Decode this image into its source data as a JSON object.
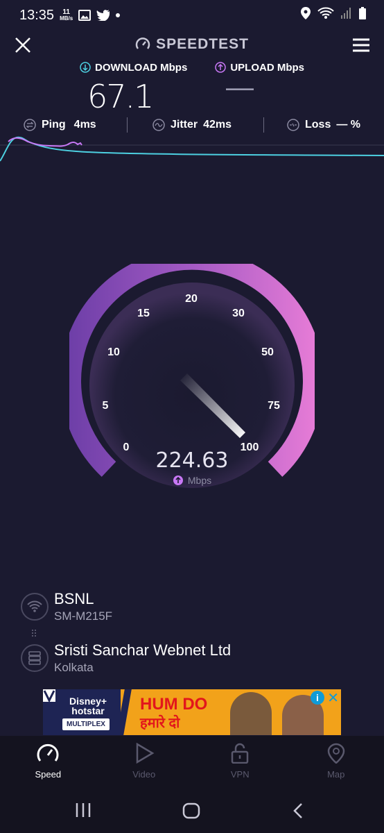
{
  "status_bar": {
    "time": "13:35",
    "net_speed_value": "11",
    "net_speed_unit": "MB/s",
    "icons": [
      "gallery-icon",
      "twitter-icon",
      "dot-icon",
      "location-icon",
      "wifi-icon",
      "signal-icon",
      "battery-icon"
    ]
  },
  "header": {
    "brand": "SPEEDTEST",
    "close_icon": "close-icon",
    "menu_icon": "hamburger-menu-icon"
  },
  "legend": {
    "download_label": "DOWNLOAD Mbps",
    "upload_label": "UPLOAD Mbps",
    "download_color": "#4dd0e1",
    "upload_color": "#c878f5"
  },
  "results": {
    "download_value": "67.1",
    "upload_value": "—"
  },
  "stats": {
    "ping_label": "Ping",
    "ping_value": "4ms",
    "jitter_label": "Jitter",
    "jitter_value": "42ms",
    "loss_label": "Loss",
    "loss_value": "— %"
  },
  "gauge": {
    "ticks": [
      "0",
      "5",
      "10",
      "15",
      "20",
      "30",
      "50",
      "75",
      "100"
    ],
    "current_value": "224.63",
    "unit": "Mbps",
    "needle_position": "100",
    "arc_color_start": "#6e3fa8",
    "arc_color_end": "#e57bd6"
  },
  "connection": {
    "provider": "BSNL",
    "device": "SM-M215F",
    "server_name": "Sristi Sanchar Webnet Ltd",
    "server_city": "Kolkata"
  },
  "ad": {
    "brand_line": "Disney+ hotstar",
    "tag": "MULTIPLEX",
    "title": "HUM DO",
    "subtitle": "हमारे दो"
  },
  "bottom_nav": {
    "items": [
      {
        "label": "Speed",
        "icon": "speedometer-icon"
      },
      {
        "label": "Video",
        "icon": "play-icon"
      },
      {
        "label": "VPN",
        "icon": "lock-icon"
      },
      {
        "label": "Map",
        "icon": "map-pin-icon"
      }
    ]
  },
  "system_nav": {
    "icons": [
      "recent-apps-icon",
      "home-icon",
      "back-icon"
    ]
  }
}
